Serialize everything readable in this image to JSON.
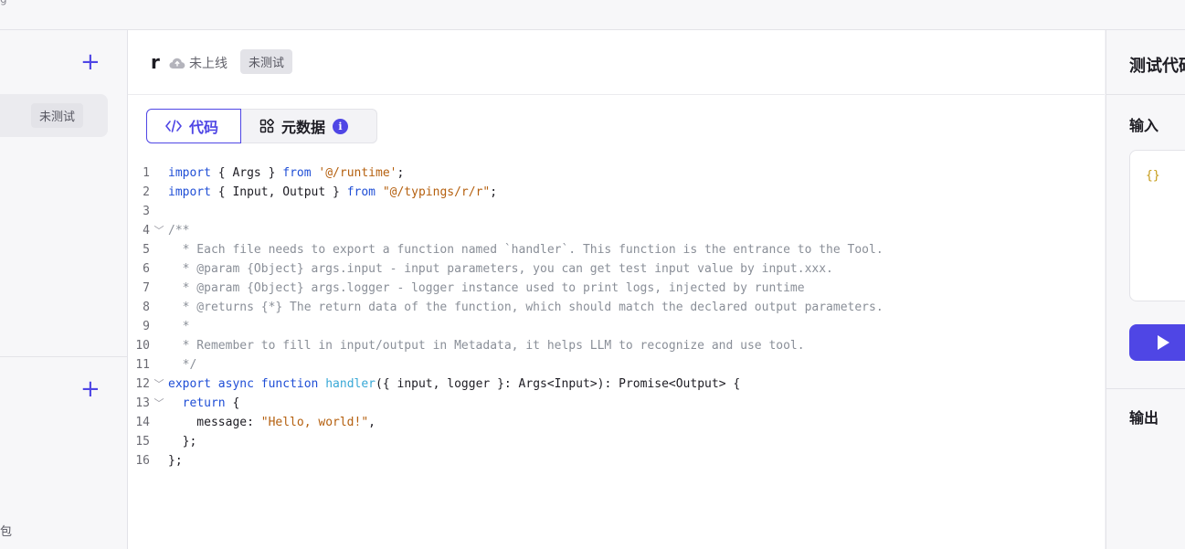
{
  "topbar": {
    "fragment": "g"
  },
  "sidebar": {
    "add_top": "+",
    "item_badge": "未测试",
    "add_bottom": "+",
    "bottom_fragment": "包"
  },
  "header": {
    "tool_name": "r",
    "status_text": "未上线",
    "test_badge": "未测试"
  },
  "tabs": {
    "code": "代码",
    "metadata": "元数据",
    "info": "i"
  },
  "code_lines": [
    {
      "n": "1",
      "fold": ""
    },
    {
      "n": "2",
      "fold": ""
    },
    {
      "n": "3",
      "fold": ""
    },
    {
      "n": "4",
      "fold": "﹀"
    },
    {
      "n": "5",
      "fold": ""
    },
    {
      "n": "6",
      "fold": ""
    },
    {
      "n": "7",
      "fold": ""
    },
    {
      "n": "8",
      "fold": ""
    },
    {
      "n": "9",
      "fold": ""
    },
    {
      "n": "10",
      "fold": ""
    },
    {
      "n": "11",
      "fold": ""
    },
    {
      "n": "12",
      "fold": "﹀"
    },
    {
      "n": "13",
      "fold": "﹀"
    },
    {
      "n": "14",
      "fold": ""
    },
    {
      "n": "15",
      "fold": ""
    },
    {
      "n": "16",
      "fold": ""
    }
  ],
  "code": {
    "l1": [
      "import",
      " { Args } ",
      "from",
      " ",
      "'@/runtime'",
      ";"
    ],
    "l2": [
      "import",
      " { Input, Output } ",
      "from",
      " ",
      "\"@/typings/r/r\"",
      ";"
    ],
    "l4": "/**",
    "l5": "  * Each file needs to export a function named `handler`. This function is the entrance to the Tool.",
    "l6": "  * @param {Object} args.input - input parameters, you can get test input value by input.xxx.",
    "l7": "  * @param {Object} args.logger - logger instance used to print logs, injected by runtime",
    "l8": "  * @returns {*} The return data of the function, which should match the declared output parameters.",
    "l9": "  *",
    "l10": "  * Remember to fill in input/output in Metadata, it helps LLM to recognize and use tool.",
    "l11": "  */",
    "l12": [
      "export",
      " ",
      "async",
      " ",
      "function",
      " ",
      "handler",
      "({ input, logger }: Args<Input>): Promise<Output> {"
    ],
    "l13": [
      "  ",
      "return",
      " {"
    ],
    "l14": [
      "    message: ",
      "\"Hello, world!\"",
      ","
    ],
    "l15": "  };",
    "l16": "};"
  },
  "right_panel": {
    "title": "测试代码",
    "input_label": "输入",
    "input_value": "{}",
    "output_label": "输出"
  }
}
